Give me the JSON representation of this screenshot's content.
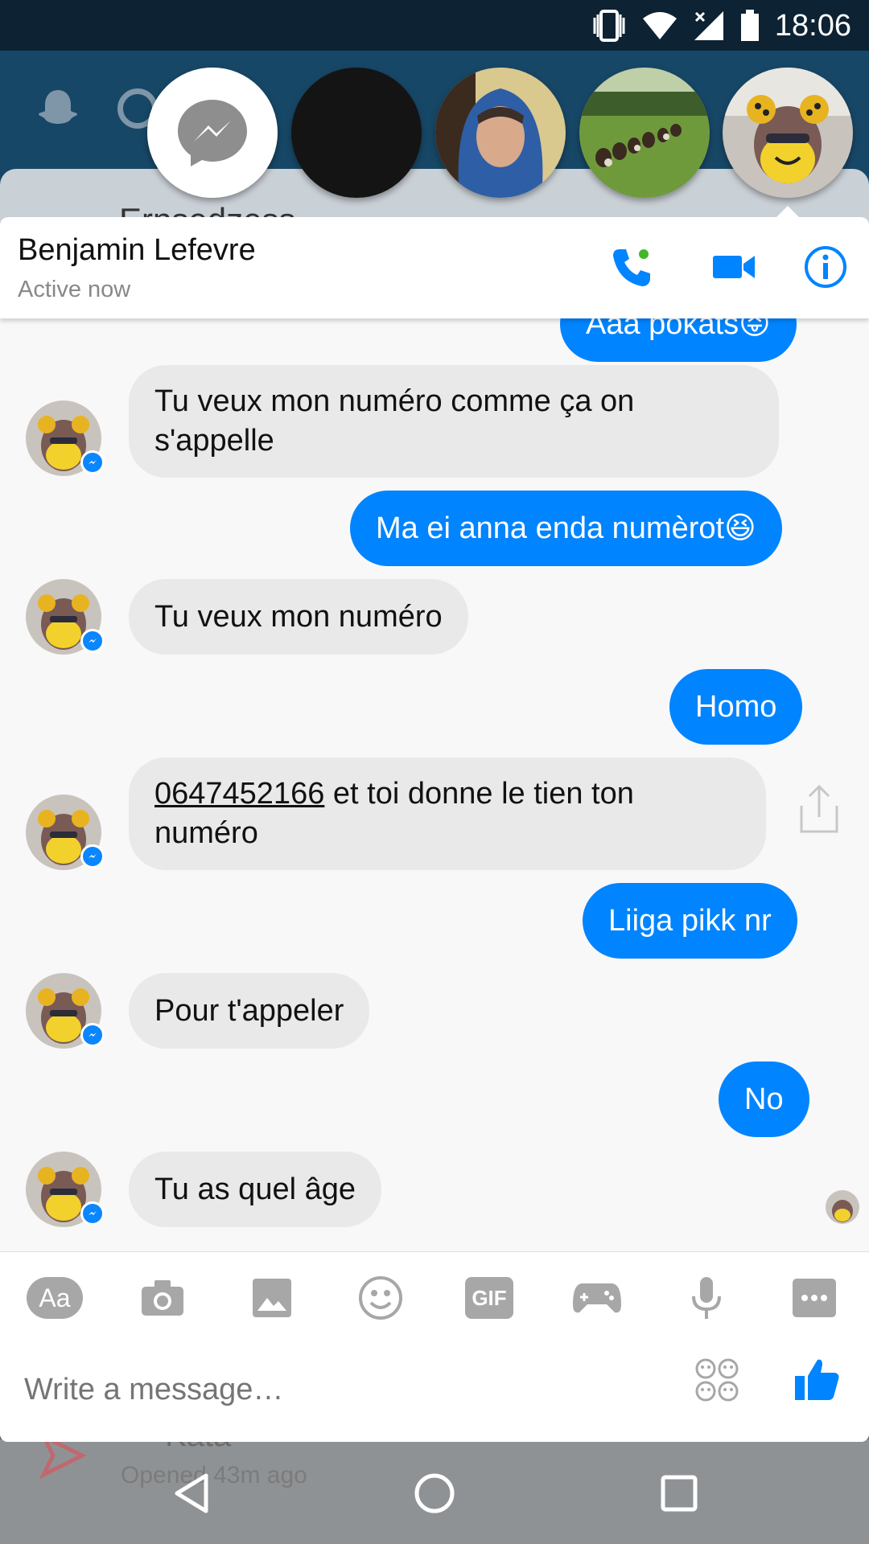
{
  "status_bar": {
    "time": "18:06"
  },
  "background_app": {
    "card_title": "Ernsedzess",
    "bottom_name": "Kata",
    "bottom_sub": "Opened 43m ago"
  },
  "chat_heads": [
    {
      "name": "messenger-head"
    },
    {
      "name": "dark-head"
    },
    {
      "name": "hooded-man-head"
    },
    {
      "name": "dogs-lawn-head"
    },
    {
      "name": "benjamin-head"
    }
  ],
  "header": {
    "name": "Benjamin Lefevre",
    "status": "Active now",
    "icons": [
      "phone-icon",
      "video-icon",
      "info-icon"
    ]
  },
  "messages": [
    {
      "dir": "out",
      "text": "Aaa pokats😝",
      "partial": true
    },
    {
      "dir": "in",
      "text": "Tu veux mon numéro comme ça on s'appelle"
    },
    {
      "dir": "out",
      "text": "Ma ei anna enda numèrot😆"
    },
    {
      "dir": "in",
      "text": "Tu veux mon numéro"
    },
    {
      "dir": "out",
      "text": "Homo"
    },
    {
      "dir": "in",
      "phone": "0647452166",
      "text": " et toi donne le tien ton numéro"
    },
    {
      "dir": "out",
      "text": "Liiga pikk nr"
    },
    {
      "dir": "in",
      "text": "Pour t'appeler"
    },
    {
      "dir": "out",
      "text": "No"
    },
    {
      "dir": "in",
      "text": "Tu as quel âge"
    }
  ],
  "composer": {
    "tools": [
      "text-format-icon",
      "camera-icon",
      "gallery-icon",
      "emoji-icon",
      "gif-icon",
      "games-icon",
      "mic-icon",
      "more-icon"
    ],
    "aa_label": "Aa",
    "gif_label": "GIF",
    "placeholder": "Write a message…"
  },
  "colors": {
    "accent": "#0084ff",
    "incoming_bubble": "#e9e9e9",
    "status_bar": "#0d2233"
  }
}
